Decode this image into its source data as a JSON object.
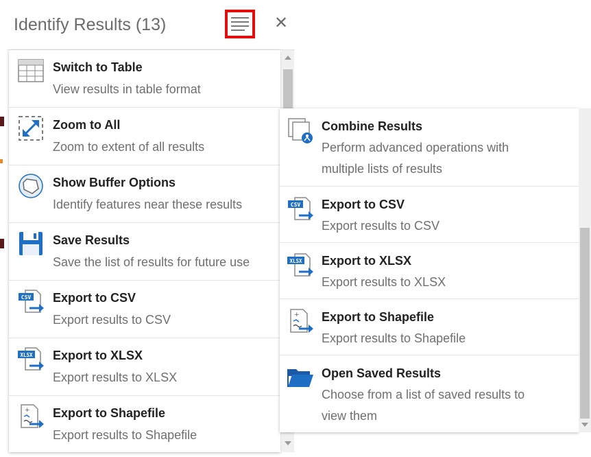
{
  "panel": {
    "title": "Identify Results (13)",
    "menu_icon": "hamburger-icon",
    "close_icon": "close-icon",
    "close_glyph": "✕",
    "highlight_color": "#e10e0e"
  },
  "left_menu": {
    "items": [
      {
        "title": "Switch to Table",
        "description": "View results in table format",
        "icon": "table-icon"
      },
      {
        "title": "Zoom to All",
        "description": "Zoom to extent of all results",
        "icon": "zoom-extent-icon"
      },
      {
        "title": "Show Buffer Options",
        "description": "Identify features near these results",
        "icon": "buffer-icon"
      },
      {
        "title": "Save Results",
        "description": "Save the list of results for future use",
        "icon": "save-icon"
      },
      {
        "title": "Export to CSV",
        "description": "Export results to CSV",
        "icon": "csv-export-icon"
      },
      {
        "title": "Export to XLSX",
        "description": "Export results to XLSX",
        "icon": "xlsx-export-icon"
      },
      {
        "title": "Export to Shapefile",
        "description": "Export results to Shapefile",
        "icon": "shapefile-export-icon"
      }
    ]
  },
  "right_menu": {
    "items": [
      {
        "title": "Combine Results",
        "description_line1": "Perform advanced operations with",
        "description_line2": "multiple lists of results",
        "icon": "combine-results-icon"
      },
      {
        "title": "Export to CSV",
        "description": "Export results to CSV",
        "icon": "csv-export-icon"
      },
      {
        "title": "Export to XLSX",
        "description": "Export results to XLSX",
        "icon": "xlsx-export-icon"
      },
      {
        "title": "Export to Shapefile",
        "description": "Export results to Shapefile",
        "icon": "shapefile-export-icon"
      },
      {
        "title": "Open Saved Results",
        "description_line1": "Choose from a list of saved results to",
        "description_line2": "view them",
        "icon": "folder-open-icon"
      }
    ]
  },
  "colors": {
    "accent_blue": "#1f6fc5",
    "title_text": "#222222",
    "desc_text": "#6f6f6f"
  }
}
